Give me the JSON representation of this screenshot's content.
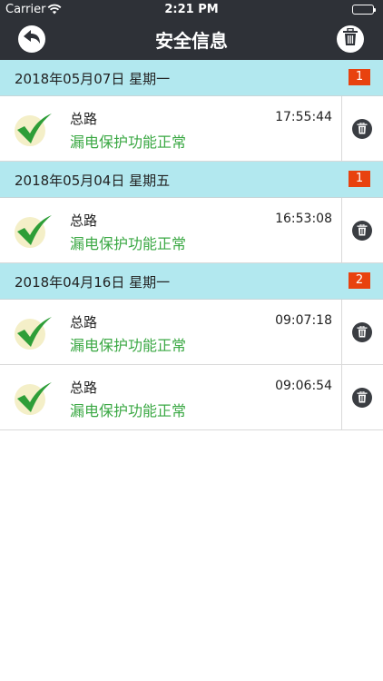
{
  "status_bar": {
    "carrier": "Carrier",
    "time": "2:21 PM"
  },
  "nav": {
    "title": "安全信息",
    "back_icon": "back-arrow-icon",
    "delete_all_icon": "trash-icon"
  },
  "colors": {
    "navbar": "#2e3137",
    "group_header": "#b2e8ef",
    "badge": "#e8420f",
    "ok_text": "#3aa843"
  },
  "groups": [
    {
      "date": "2018年05月07日 星期一",
      "count": "1",
      "items": [
        {
          "title": "总路",
          "status": "漏电保护功能正常",
          "time": "17:55:44"
        }
      ]
    },
    {
      "date": "2018年05月04日 星期五",
      "count": "1",
      "items": [
        {
          "title": "总路",
          "status": "漏电保护功能正常",
          "time": "16:53:08"
        }
      ]
    },
    {
      "date": "2018年04月16日 星期一",
      "count": "2",
      "items": [
        {
          "title": "总路",
          "status": "漏电保护功能正常",
          "time": "09:07:18"
        },
        {
          "title": "总路",
          "status": "漏电保护功能正常",
          "time": "09:06:54"
        }
      ]
    }
  ]
}
